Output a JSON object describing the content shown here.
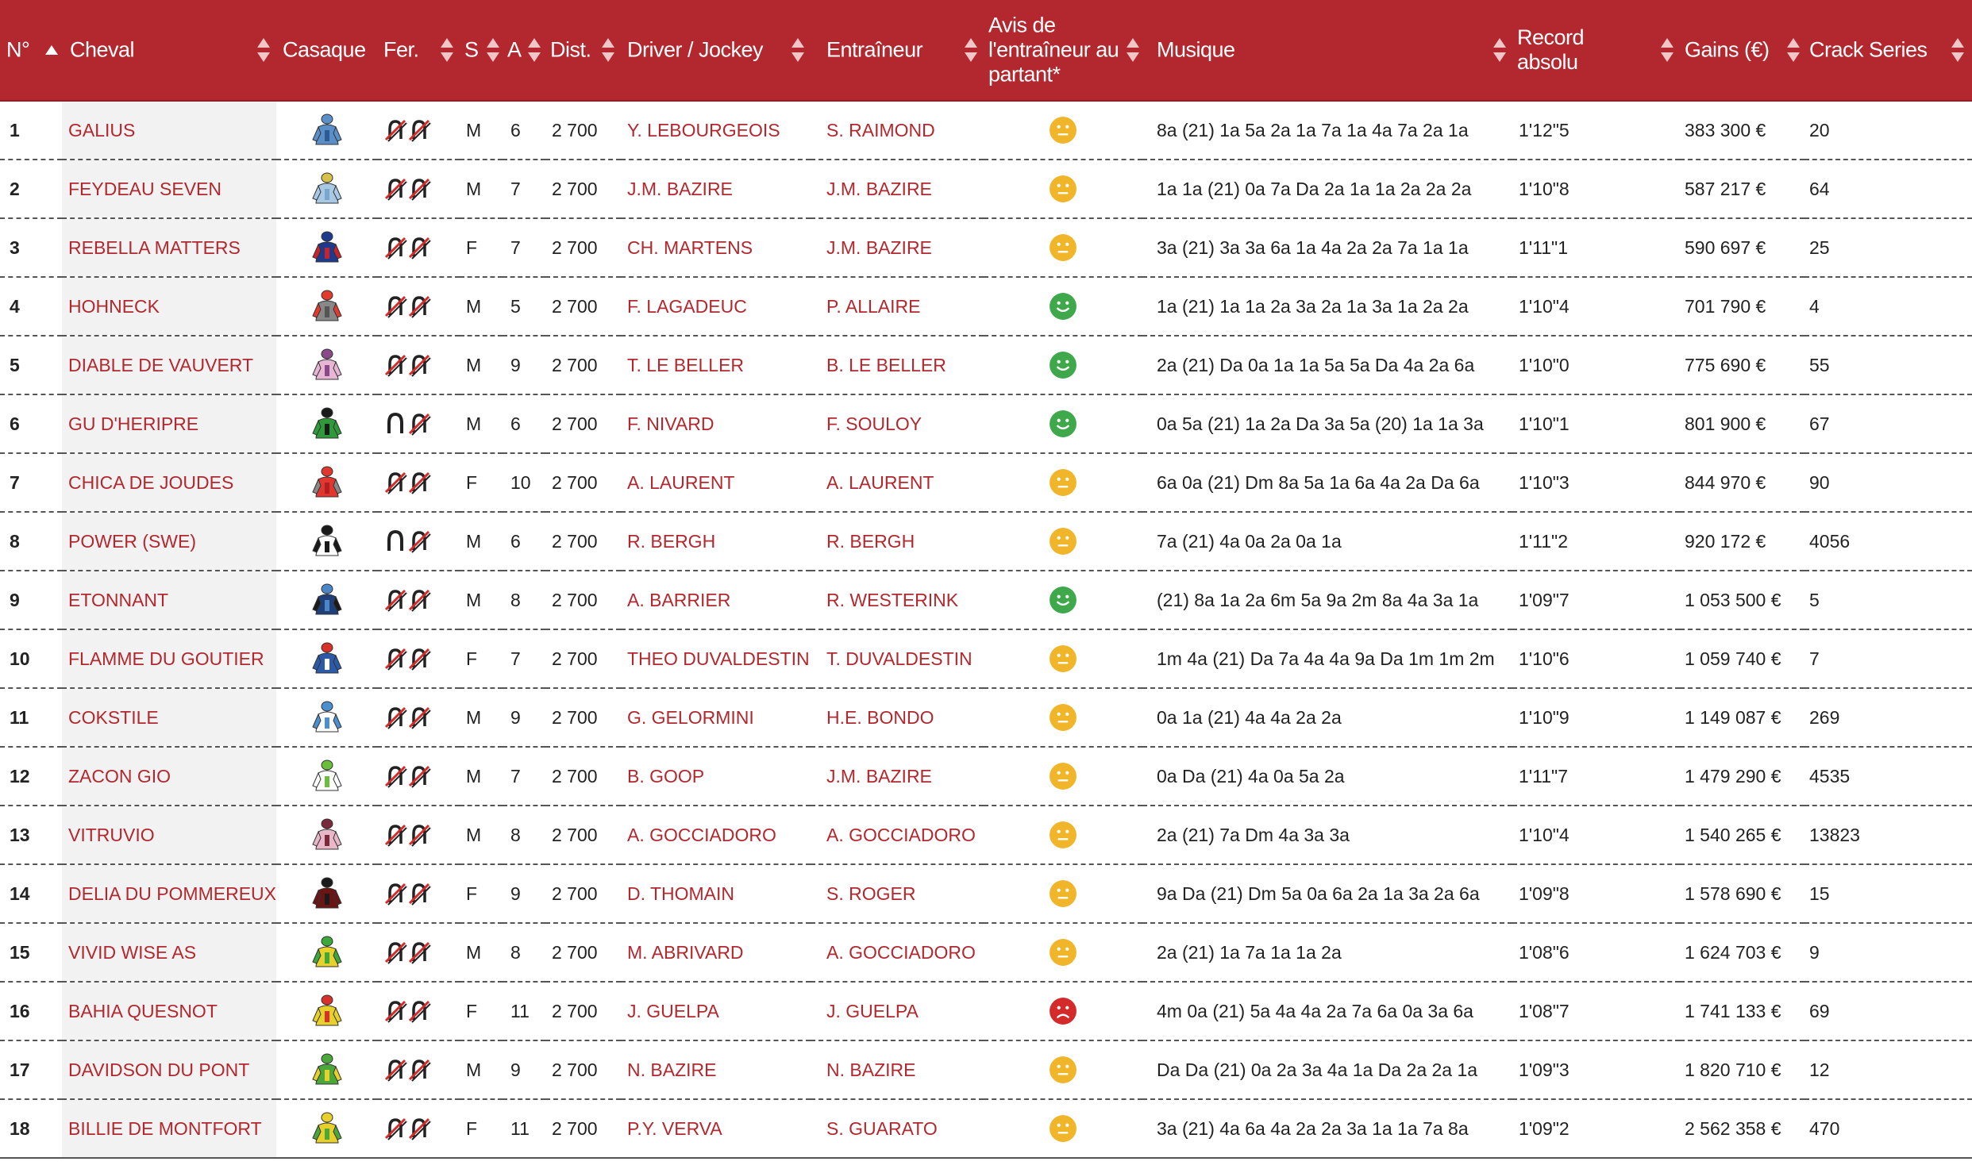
{
  "headers": {
    "num": "N°",
    "horse": "Cheval",
    "silk": "Casaque",
    "shoe": "Fer.",
    "sex": "S",
    "age": "A",
    "dist": "Dist.",
    "driver": "Driver / Jockey",
    "trainer": "Entraîneur",
    "avis_line1": "Avis de",
    "avis_line2": "l'entraîneur au",
    "avis_line3": "partant*",
    "music": "Musique",
    "record": "Record absolu",
    "gains": "Gains (€)",
    "crack": "Crack Series"
  },
  "colors": {
    "header_bg": "#b3282e",
    "link_red": "#b3282e",
    "face_neutral": "#f0b528",
    "face_happy": "#3ea84a",
    "face_sad": "#d42a2a"
  },
  "rows": [
    {
      "num": "1",
      "horse": "GALIUS",
      "silk": {
        "body": "#5b8fc7",
        "sleeve": "#5b8fc7",
        "cap": "#5b8fc7",
        "accent": "#2d5b94"
      },
      "shoe": "D4",
      "sex": "M",
      "age": "6",
      "dist": "2 700",
      "driver": "Y. LEBOURGEOIS",
      "trainer": "S. RAIMOND",
      "avis": "neutral",
      "music": "8a (21) 1a 5a 2a 1a 7a 1a 4a 7a 2a 1a",
      "record": "1'12\"5",
      "gains": "383 300 €",
      "crack": "20"
    },
    {
      "num": "2",
      "horse": "FEYDEAU SEVEN",
      "silk": {
        "body": "#a8c8e4",
        "sleeve": "#a8c8e4",
        "cap": "#d6c24a",
        "accent": "#7aa6cc"
      },
      "shoe": "D4",
      "sex": "M",
      "age": "7",
      "dist": "2 700",
      "driver": "J.M. BAZIRE",
      "trainer": "J.M. BAZIRE",
      "avis": "neutral",
      "music": "1a 1a (21) 0a 7a Da 2a 1a 1a 2a 2a 2a",
      "record": "1'10\"8",
      "gains": "587 217 €",
      "crack": "64"
    },
    {
      "num": "3",
      "horse": "REBELLA MATTERS",
      "silk": {
        "body": "#1d3a8c",
        "sleeve": "#c8232b",
        "cap": "#1d3a8c",
        "accent": "#c8232b"
      },
      "shoe": "D4",
      "sex": "F",
      "age": "7",
      "dist": "2 700",
      "driver": "CH. MARTENS",
      "trainer": "J.M. BAZIRE",
      "avis": "neutral",
      "music": "3a (21) 3a 3a 6a 1a 4a 2a 2a 7a 1a 1a",
      "record": "1'11\"1",
      "gains": "590 697 €",
      "crack": "25"
    },
    {
      "num": "4",
      "horse": "HOHNECK",
      "silk": {
        "body": "#888888",
        "sleeve": "#e23b2e",
        "cap": "#e23b2e",
        "accent": "#555555"
      },
      "shoe": "D4",
      "sex": "M",
      "age": "5",
      "dist": "2 700",
      "driver": "F. LAGADEUC",
      "trainer": "P. ALLAIRE",
      "avis": "happy",
      "music": "1a (21) 1a 1a 2a 3a 2a 1a 3a 1a 2a 2a",
      "record": "1'10\"4",
      "gains": "701 790 €",
      "crack": "4"
    },
    {
      "num": "5",
      "horse": "DIABLE DE VAUVERT",
      "silk": {
        "body": "#e6b6d4",
        "sleeve": "#e6b6d4",
        "cap": "#8a4a8a",
        "accent": "#8a4a8a"
      },
      "shoe": "D4",
      "sex": "M",
      "age": "9",
      "dist": "2 700",
      "driver": "T. LE BELLER",
      "trainer": "B. LE BELLER",
      "avis": "happy",
      "music": "2a (21) Da 0a 1a 1a 5a 5a Da 4a 2a 6a",
      "record": "1'10\"0",
      "gains": "775 690 €",
      "crack": "55"
    },
    {
      "num": "6",
      "horse": "GU D'HERIPRE",
      "silk": {
        "body": "#2e9a3a",
        "sleeve": "#2e9a3a",
        "cap": "#1a1a1a",
        "accent": "#1a1a1a"
      },
      "shoe": "DP",
      "sex": "M",
      "age": "6",
      "dist": "2 700",
      "driver": "F. NIVARD",
      "trainer": "F. SOULOY",
      "avis": "happy",
      "music": "0a 5a (21) 1a 2a Da 3a 5a (20) 1a 1a 3a",
      "record": "1'10\"1",
      "gains": "801 900 €",
      "crack": "67"
    },
    {
      "num": "7",
      "horse": "CHICA DE JOUDES",
      "silk": {
        "body": "#e2372e",
        "sleeve": "#888888",
        "cap": "#e2372e",
        "accent": "#b02020"
      },
      "shoe": "D4",
      "sex": "F",
      "age": "10",
      "dist": "2 700",
      "driver": "A. LAURENT",
      "trainer": "A. LAURENT",
      "avis": "neutral",
      "music": "6a 0a (21) Dm 8a 5a 1a 6a 4a 2a Da 6a",
      "record": "1'10\"3",
      "gains": "844 970 €",
      "crack": "90"
    },
    {
      "num": "8",
      "horse": "POWER (SWE)",
      "silk": {
        "body": "#ffffff",
        "sleeve": "#1a1a1a",
        "cap": "#1a1a1a",
        "accent": "#1a1a1a"
      },
      "shoe": "DP",
      "sex": "M",
      "age": "6",
      "dist": "2 700",
      "driver": "R. BERGH",
      "trainer": "R. BERGH",
      "avis": "neutral",
      "music": "7a (21) 4a 0a 2a 0a 1a",
      "record": "1'11\"2",
      "gains": "920 172 €",
      "crack": "4056"
    },
    {
      "num": "9",
      "horse": "ETONNANT",
      "silk": {
        "body": "#1e3f7a",
        "sleeve": "#1a1a1a",
        "cap": "#4a86c8",
        "accent": "#4a86c8"
      },
      "shoe": "D4",
      "sex": "M",
      "age": "8",
      "dist": "2 700",
      "driver": "A. BARRIER",
      "trainer": "R. WESTERINK",
      "avis": "happy",
      "music": "(21) 8a 1a 2a 6m 5a 9a 2m 8a 4a 3a 1a",
      "record": "1'09\"7",
      "gains": "1 053 500 €",
      "crack": "5"
    },
    {
      "num": "10",
      "horse": "FLAMME DU GOUTIER",
      "silk": {
        "body": "#2a5aa8",
        "sleeve": "#2a5aa8",
        "cap": "#d8302a",
        "accent": "#ffffff"
      },
      "shoe": "D4",
      "sex": "F",
      "age": "7",
      "dist": "2 700",
      "driver": "THEO DUVALDESTIN",
      "trainer": "T. DUVALDESTIN",
      "avis": "neutral",
      "music": "1m 4a (21) Da 7a 4a 4a 9a Da 1m 1m 2m",
      "record": "1'10\"6",
      "gains": "1 059 740 €",
      "crack": "7"
    },
    {
      "num": "11",
      "horse": "COKSTILE",
      "silk": {
        "body": "#ffffff",
        "sleeve": "#4a8fd0",
        "cap": "#4a8fd0",
        "accent": "#4a8fd0"
      },
      "shoe": "D4",
      "sex": "M",
      "age": "9",
      "dist": "2 700",
      "driver": "G. GELORMINI",
      "trainer": "H.E. BONDO",
      "avis": "neutral",
      "music": "0a 1a (21) 4a 4a 2a 2a",
      "record": "1'10\"9",
      "gains": "1 149 087 €",
      "crack": "269"
    },
    {
      "num": "12",
      "horse": "ZACON GIO",
      "silk": {
        "body": "#ffffff",
        "sleeve": "#ffffff",
        "cap": "#6abf3a",
        "accent": "#6abf3a"
      },
      "shoe": "D4",
      "sex": "M",
      "age": "7",
      "dist": "2 700",
      "driver": "B. GOOP",
      "trainer": "J.M. BAZIRE",
      "avis": "neutral",
      "music": "0a Da (21) 4a 0a 5a 2a",
      "record": "1'11\"7",
      "gains": "1 479 290 €",
      "crack": "4535"
    },
    {
      "num": "13",
      "horse": "VITRUVIO",
      "silk": {
        "body": "#e8b8c8",
        "sleeve": "#e8b8c8",
        "cap": "#7a2a3a",
        "accent": "#7a2a3a"
      },
      "shoe": "D4",
      "sex": "M",
      "age": "8",
      "dist": "2 700",
      "driver": "A. GOCCIADORO",
      "trainer": "A. GOCCIADORO",
      "avis": "neutral",
      "music": "2a (21) 7a Dm 4a 3a 3a",
      "record": "1'10\"4",
      "gains": "1 540 265 €",
      "crack": "13823"
    },
    {
      "num": "14",
      "horse": "DELIA DU POMMEREUX",
      "silk": {
        "body": "#6a1414",
        "sleeve": "#6a1414",
        "cap": "#1a1a1a",
        "accent": "#1a1a1a"
      },
      "shoe": "D4",
      "sex": "F",
      "age": "9",
      "dist": "2 700",
      "driver": "D. THOMAIN",
      "trainer": "S. ROGER",
      "avis": "neutral",
      "music": "9a Da (21) Dm 5a 0a 6a 2a 1a 3a 2a 6a",
      "record": "1'09\"8",
      "gains": "1 578 690 €",
      "crack": "15"
    },
    {
      "num": "15",
      "horse": "VIVID WISE AS",
      "silk": {
        "body": "#e6d22a",
        "sleeve": "#3aa83a",
        "cap": "#3aa83a",
        "accent": "#3aa83a"
      },
      "shoe": "D4",
      "sex": "M",
      "age": "8",
      "dist": "2 700",
      "driver": "M. ABRIVARD",
      "trainer": "A. GOCCIADORO",
      "avis": "neutral",
      "music": "2a (21) 1a 7a 1a 1a 2a",
      "record": "1'08\"6",
      "gains": "1 624 703 €",
      "crack": "9"
    },
    {
      "num": "16",
      "horse": "BAHIA QUESNOT",
      "silk": {
        "body": "#e8d02a",
        "sleeve": "#e8d02a",
        "cap": "#d8302a",
        "accent": "#d8302a"
      },
      "shoe": "D4",
      "sex": "F",
      "age": "11",
      "dist": "2 700",
      "driver": "J. GUELPA",
      "trainer": "J. GUELPA",
      "avis": "sad",
      "music": "4m 0a (21) 5a 4a 4a 2a 7a 6a 0a 3a 6a",
      "record": "1'08\"7",
      "gains": "1 741 133 €",
      "crack": "69"
    },
    {
      "num": "17",
      "horse": "DAVIDSON DU PONT",
      "silk": {
        "body": "#4aa83a",
        "sleeve": "#e8d02a",
        "cap": "#4aa83a",
        "accent": "#e8d02a"
      },
      "shoe": "D4",
      "sex": "M",
      "age": "9",
      "dist": "2 700",
      "driver": "N. BAZIRE",
      "trainer": "N. BAZIRE",
      "avis": "neutral",
      "music": "Da Da (21) 0a 2a 3a 4a 1a Da 2a 2a 1a",
      "record": "1'09\"3",
      "gains": "1 820 710 €",
      "crack": "12"
    },
    {
      "num": "18",
      "horse": "BILLIE DE MONTFORT",
      "silk": {
        "body": "#e8d02a",
        "sleeve": "#4aa83a",
        "cap": "#e8d02a",
        "accent": "#4aa83a"
      },
      "shoe": "D4",
      "sex": "F",
      "age": "11",
      "dist": "2 700",
      "driver": "P.Y. VERVA",
      "trainer": "S. GUARATO",
      "avis": "neutral",
      "music": "3a (21) 4a 6a 4a 2a 2a 3a 1a 1a 7a 8a",
      "record": "1'09\"2",
      "gains": "2 562 358 €",
      "crack": "470"
    }
  ]
}
